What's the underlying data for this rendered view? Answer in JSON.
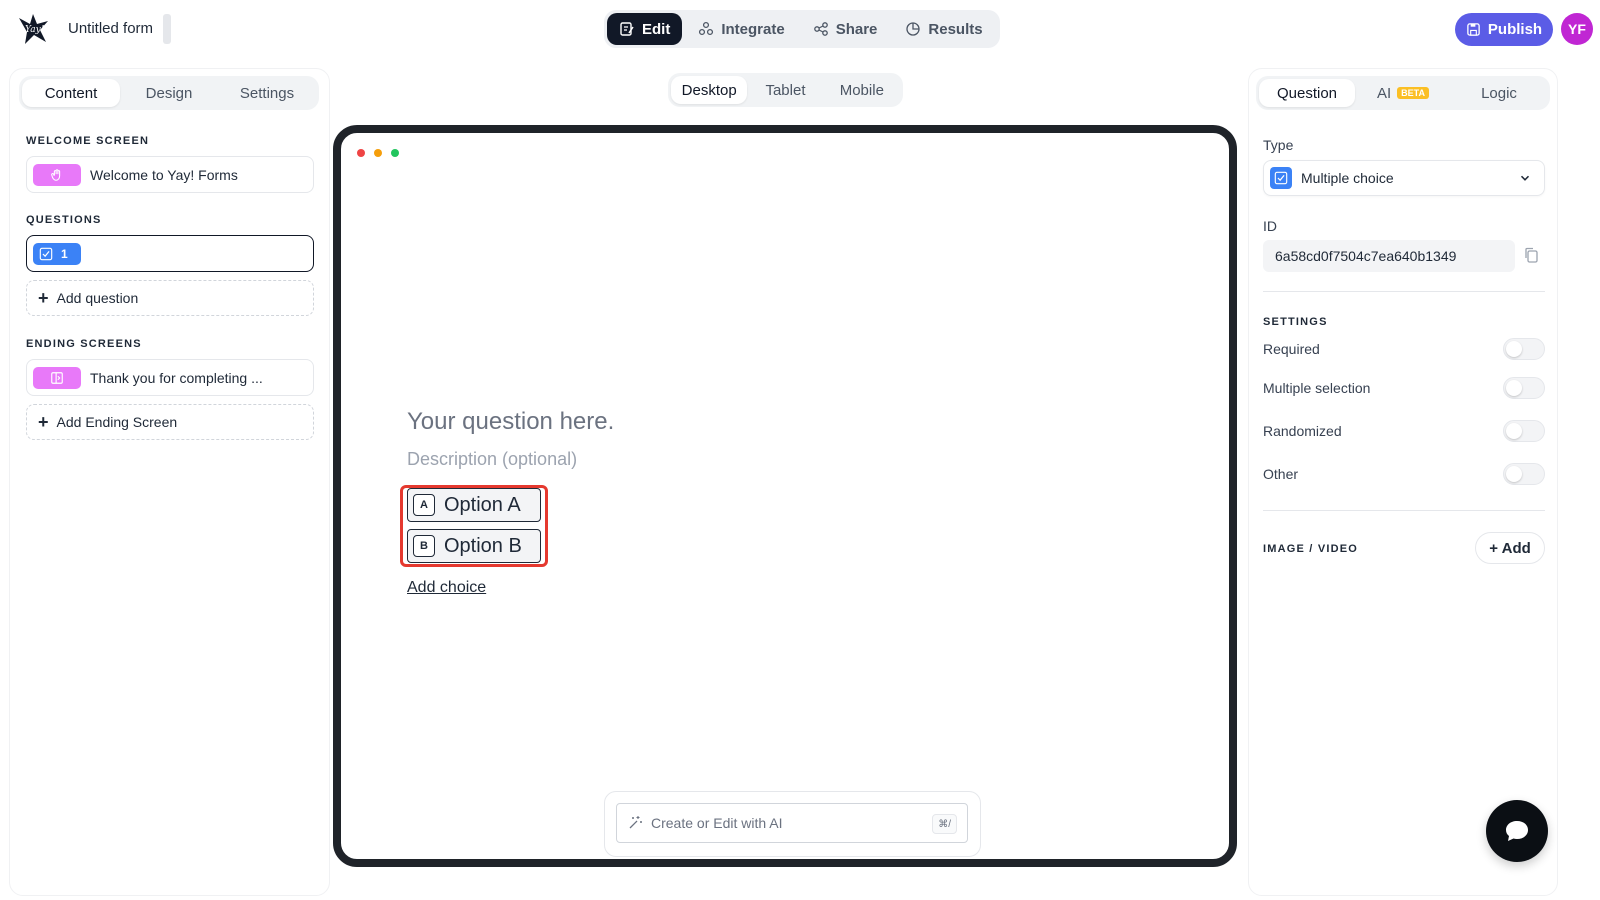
{
  "header": {
    "form_title": "Untitled form",
    "nav": [
      {
        "label": "Edit",
        "icon": "edit-icon",
        "active": true
      },
      {
        "label": "Integrate",
        "icon": "integrate-icon",
        "active": false
      },
      {
        "label": "Share",
        "icon": "share-icon",
        "active": false
      },
      {
        "label": "Results",
        "icon": "results-icon",
        "active": false
      }
    ],
    "publish_label": "Publish",
    "avatar_initials": "YF",
    "colors": {
      "publish": "#5b5ce6",
      "avatar": "#c026d3",
      "active_tab": "#111827"
    }
  },
  "left_panel": {
    "tabs": [
      "Content",
      "Design",
      "Settings"
    ],
    "active_tab": "Content",
    "welcome_label": "WELCOME SCREEN",
    "welcome_item": "Welcome to Yay! Forms",
    "questions_label": "QUESTIONS",
    "question_number": "1",
    "add_question": "Add question",
    "ending_label": "ENDING SCREENS",
    "ending_item": "Thank you for completing ...",
    "add_ending": "Add Ending Screen"
  },
  "center": {
    "device_tabs": [
      "Desktop",
      "Tablet",
      "Mobile"
    ],
    "active_device": "Desktop",
    "question_placeholder": "Your question here.",
    "description_placeholder": "Description (optional)",
    "choices": [
      {
        "key": "A",
        "label": "Option A"
      },
      {
        "key": "B",
        "label": "Option B"
      }
    ],
    "add_choice": "Add choice",
    "ai_placeholder": "Create or Edit with AI",
    "ai_shortcut": "⌘/"
  },
  "right_panel": {
    "tabs": [
      "Question",
      "AI",
      "Logic"
    ],
    "beta_badge": "BETA",
    "active_tab": "Question",
    "type_label": "Type",
    "type_value": "Multiple choice",
    "id_label": "ID",
    "id_value": "6a58cd0f7504c7ea640b1349",
    "settings_label": "SETTINGS",
    "settings": [
      {
        "label": "Required",
        "on": false
      },
      {
        "label": "Multiple selection",
        "on": false
      },
      {
        "label": "Randomized",
        "on": false
      },
      {
        "label": "Other",
        "on": false
      }
    ],
    "media_label": "IMAGE / VIDEO",
    "add_media": "+ Add"
  }
}
